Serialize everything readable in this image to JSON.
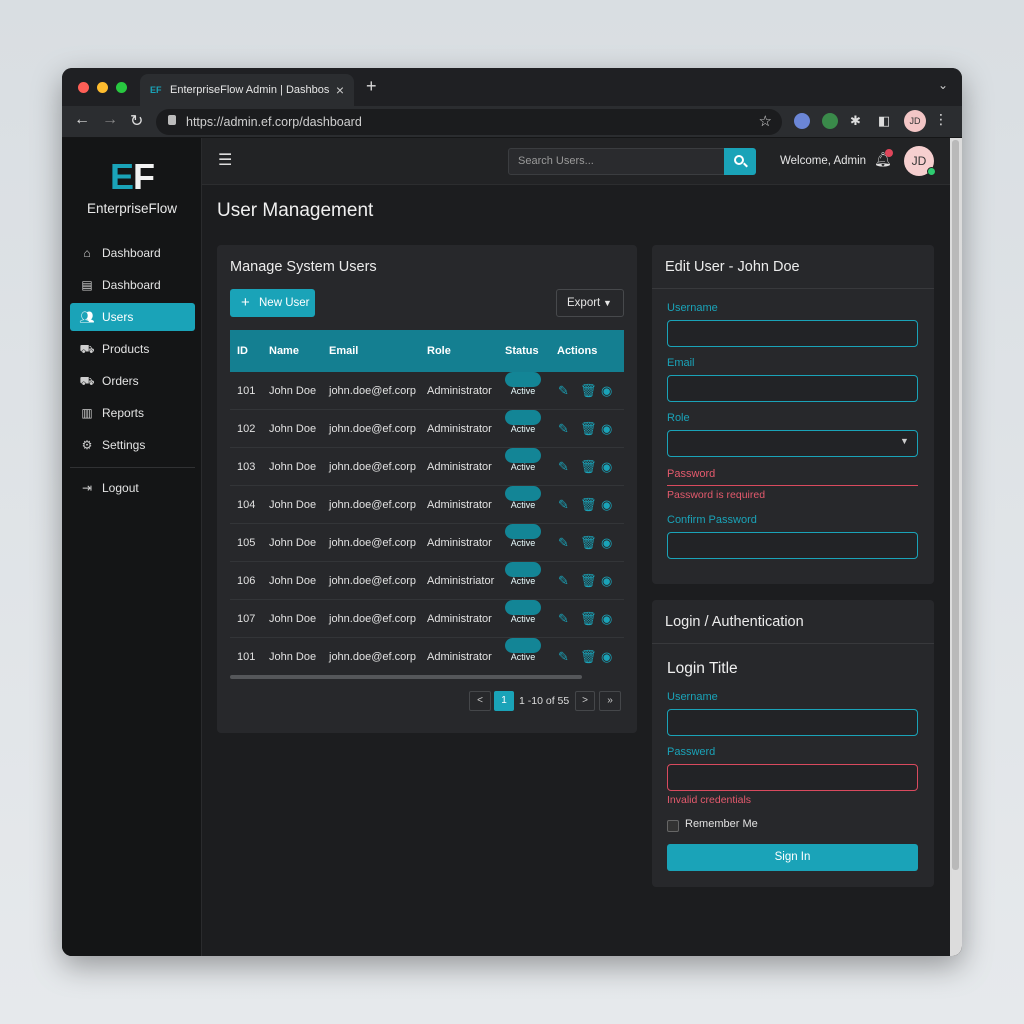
{
  "browser": {
    "tab_title": "EnterpriseFlow Admin | Dashbos",
    "favicon_text": "EF",
    "url": "https://admin.ef.corp/dashboard",
    "profile_initials": "JD"
  },
  "colors": {
    "accent": "#1aa3b8",
    "table_header": "#147f91",
    "error": "#d94a5e",
    "background": "#1c1d1f"
  },
  "sidebar": {
    "logo_e": "E",
    "logo_f": "F",
    "brand": "EnterpriseFlow",
    "items": [
      {
        "label": "Dashboard",
        "icon": "home-icon"
      },
      {
        "label": "Dashboard",
        "icon": "dashboard-icon"
      },
      {
        "label": "Users",
        "icon": "users-icon",
        "active": true
      },
      {
        "label": "Products",
        "icon": "cart-icon"
      },
      {
        "label": "Orders",
        "icon": "cart-icon"
      },
      {
        "label": "Reports",
        "icon": "chart-icon"
      },
      {
        "label": "Settings",
        "icon": "gear-icon"
      }
    ],
    "logout": {
      "label": "Logout",
      "icon": "logout-icon"
    }
  },
  "header": {
    "search_placeholder": "Search Users...",
    "welcome": "Welcome, Admin",
    "avatar_initials": "JD"
  },
  "page": {
    "title": "User Management"
  },
  "users_card": {
    "title": "Manage System Users",
    "new_user_label": "New User",
    "export_label": "Export",
    "columns": [
      "ID",
      "Name",
      "Email",
      "Role",
      "Status",
      "Actions"
    ],
    "rows": [
      {
        "id": "101",
        "name": "John Doe",
        "email": "john.doe@ef.corp",
        "role": "Administrator",
        "status": "Active"
      },
      {
        "id": "102",
        "name": "John Doe",
        "email": "john.doe@ef.corp",
        "role": "Administrator",
        "status": "Active"
      },
      {
        "id": "103",
        "name": "John Doe",
        "email": "john.doe@ef.corp",
        "role": "Administrator",
        "status": "Active"
      },
      {
        "id": "104",
        "name": "John Doe",
        "email": "john.doe@ef.corp",
        "role": "Administrator",
        "status": "Active"
      },
      {
        "id": "105",
        "name": "John Doe",
        "email": "john.doe@ef.corp",
        "role": "Administrator",
        "status": "Active"
      },
      {
        "id": "106",
        "name": "John Doe",
        "email": "john.doe@ef.corp",
        "role": "Administriator",
        "status": "Active"
      },
      {
        "id": "107",
        "name": "John Doe",
        "email": "john.doe@ef.corp",
        "role": "Administrator",
        "status": "Active"
      },
      {
        "id": "101",
        "name": "John Doe",
        "email": "john.doe@ef.corp",
        "role": "Administrator",
        "status": "Active"
      }
    ],
    "pagination": {
      "prev": "<",
      "page": "1",
      "info": "1 -10 of 55",
      "next": ">",
      "last": "»"
    }
  },
  "edit_card": {
    "title": "Edit User - John Doe",
    "username_label": "Username",
    "username_value": "",
    "email_label": "Email",
    "email_value": "",
    "role_label": "Role",
    "role_value": "",
    "password_label": "Password",
    "password_error": "Password is required",
    "confirm_label": "Confirm Password",
    "confirm_value": ""
  },
  "login_card": {
    "title": "Login / Authentication",
    "subtitle": "Login Title",
    "username_label": "Username",
    "username_value": "",
    "password_label": "Passwerd",
    "password_value": "",
    "error": "Invalid credentials",
    "remember_label": "Remember Me",
    "signin_label": "Sign In"
  }
}
